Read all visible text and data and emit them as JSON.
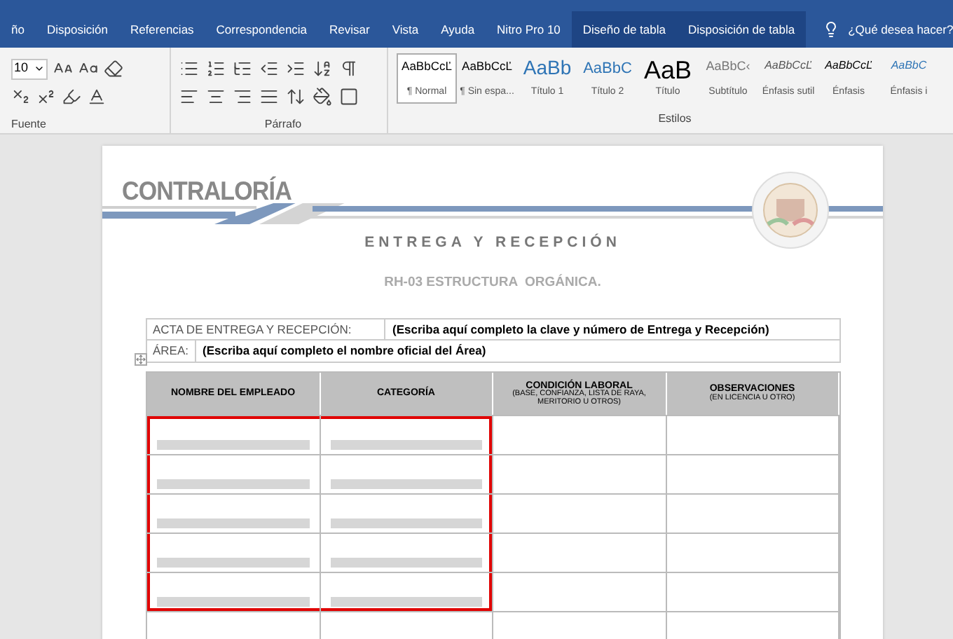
{
  "menu_tabs": [
    {
      "label": "ño",
      "selected": false,
      "contextual": false
    },
    {
      "label": "Disposición",
      "selected": false,
      "contextual": false
    },
    {
      "label": "Referencias",
      "selected": false,
      "contextual": false
    },
    {
      "label": "Correspondencia",
      "selected": false,
      "contextual": false
    },
    {
      "label": "Revisar",
      "selected": false,
      "contextual": false
    },
    {
      "label": "Vista",
      "selected": false,
      "contextual": false
    },
    {
      "label": "Ayuda",
      "selected": false,
      "contextual": false
    },
    {
      "label": "Nitro Pro 10",
      "selected": false,
      "contextual": false
    },
    {
      "label": "Diseño de tabla",
      "selected": false,
      "contextual": true
    },
    {
      "label": "Disposición de tabla",
      "selected": false,
      "contextual": true
    }
  ],
  "tell_me": {
    "placeholder": "¿Qué desea hacer?"
  },
  "ribbon": {
    "font_size": "10",
    "font_group": "Fuente",
    "paragraph_group": "Párrafo",
    "styles_group": "Estilos",
    "styles": [
      {
        "preview": "AaBbCcĽ",
        "name": "¶ Normal",
        "kind": "normal",
        "selected": true
      },
      {
        "preview": "AaBbCcĽ",
        "name": "¶ Sin espa...",
        "kind": "normal",
        "selected": false
      },
      {
        "preview": "AaBb",
        "name": "Título 1",
        "kind": "heading1",
        "selected": false
      },
      {
        "preview": "AaBbC",
        "name": "Título 2",
        "kind": "heading2",
        "selected": false
      },
      {
        "preview": "AaB",
        "name": "Título",
        "kind": "title",
        "selected": false
      },
      {
        "preview": "AaBbC‹",
        "name": "Subtítulo",
        "kind": "subtitle",
        "selected": false
      },
      {
        "preview": "AaBbCcĽ",
        "name": "Énfasis sutil",
        "kind": "subtle",
        "selected": false
      },
      {
        "preview": "AaBbCcĽ",
        "name": "Énfasis",
        "kind": "emphasis",
        "selected": false
      },
      {
        "preview": "AaBbC",
        "name": "Énfasis i",
        "kind": "intense",
        "selected": false
      }
    ]
  },
  "document": {
    "logo": "CONTRALORÍA",
    "title": "ENTREGA Y RECEPCIÓN",
    "subtitle": "RH-03 ESTRUCTURA  ORGÁNICA.",
    "act_label": "ACTA DE ENTREGA Y RECEPCIÓN:",
    "act_value": "(Escriba aquí completo la clave y número de Entrega y Recepción)",
    "area_label": "ÁREA:",
    "area_value": "(Escriba aquí completo el nombre oficial del Área)",
    "table": {
      "columns": [
        {
          "title": "NOMBRE DEL EMPLEADO"
        },
        {
          "title": "CATEGORÍA"
        },
        {
          "title": "CONDICIÓN LABORAL",
          "note": "(BASE, CONFIANZA, LISTA DE RAYA, MERITORIO U OTROS)"
        },
        {
          "title": "OBSERVACIONES",
          "note": "(EN LICENCIA U OTRO)"
        }
      ],
      "rows": [
        {
          "shaded": true
        },
        {
          "shaded": true
        },
        {
          "shaded": true
        },
        {
          "shaded": true
        },
        {
          "shaded": true
        },
        {
          "shaded": false
        }
      ]
    }
  }
}
